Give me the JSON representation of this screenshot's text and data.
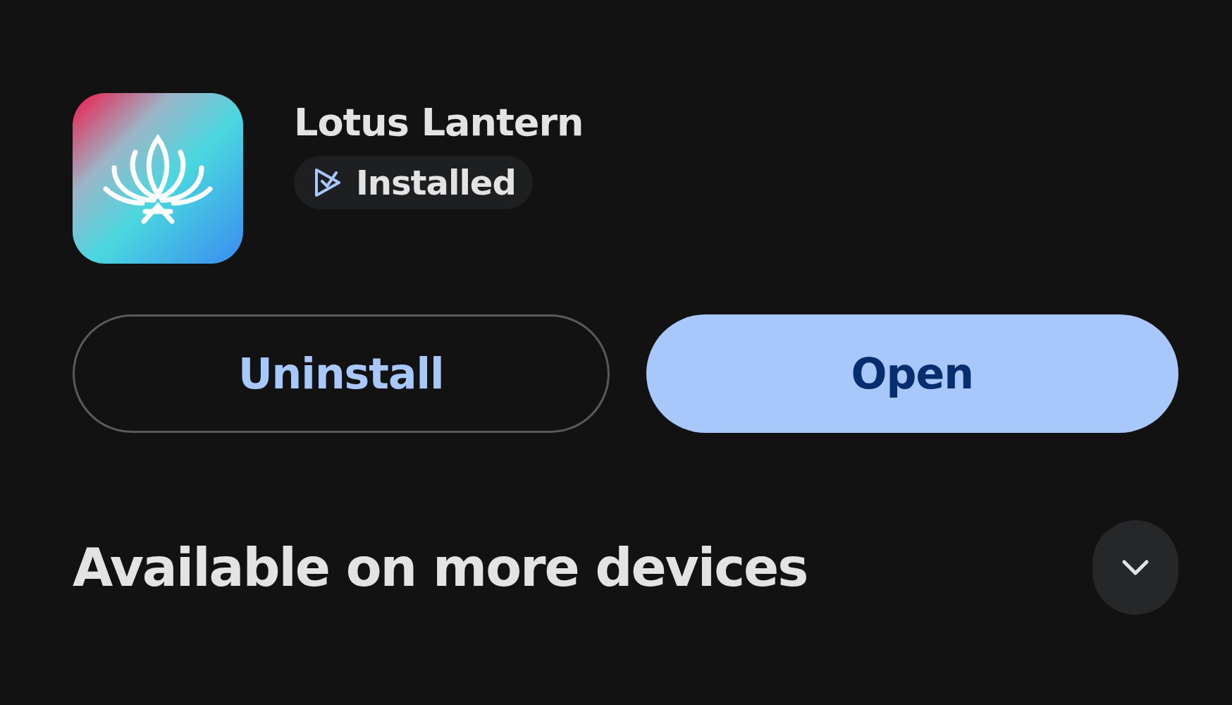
{
  "app": {
    "name": "Lotus Lantern",
    "status": "Installed"
  },
  "buttons": [
    {
      "label": "Uninstall",
      "kind": "outlined"
    },
    {
      "label": "Open",
      "kind": "filled"
    }
  ],
  "section": {
    "title": "Available on more devices",
    "expanded": false
  }
}
